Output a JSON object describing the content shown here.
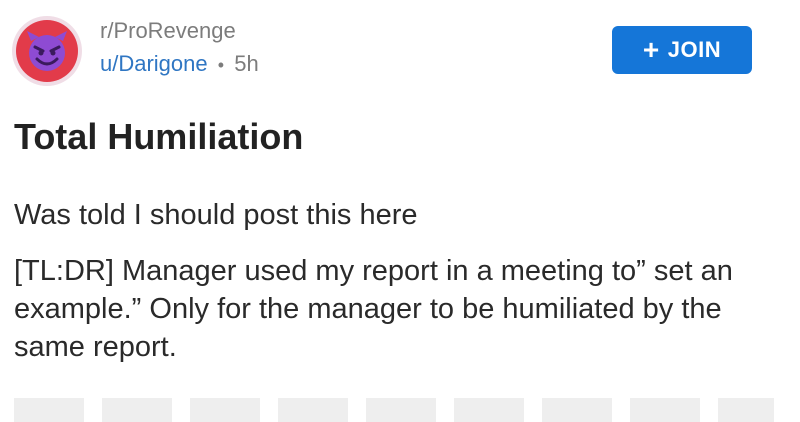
{
  "post": {
    "subreddit": "r/ProRevenge",
    "username": "u/Darigone",
    "separator": "•",
    "age": "5h",
    "join_label": "JOIN",
    "join_icon": "plus-icon",
    "avatar_icon": "devil-smiley-icon",
    "title": "Total Humiliation",
    "body": [
      "Was told I should post this here",
      "[TL:DR] Manager used my report in a meeting to” set an example.”  Only for the manager to be humiliated by the same report."
    ]
  },
  "colors": {
    "join_button": "#1576d8",
    "username": "#2f76c3",
    "avatar_ring": "#e23b4a",
    "avatar_face": "#8e4bd3"
  }
}
